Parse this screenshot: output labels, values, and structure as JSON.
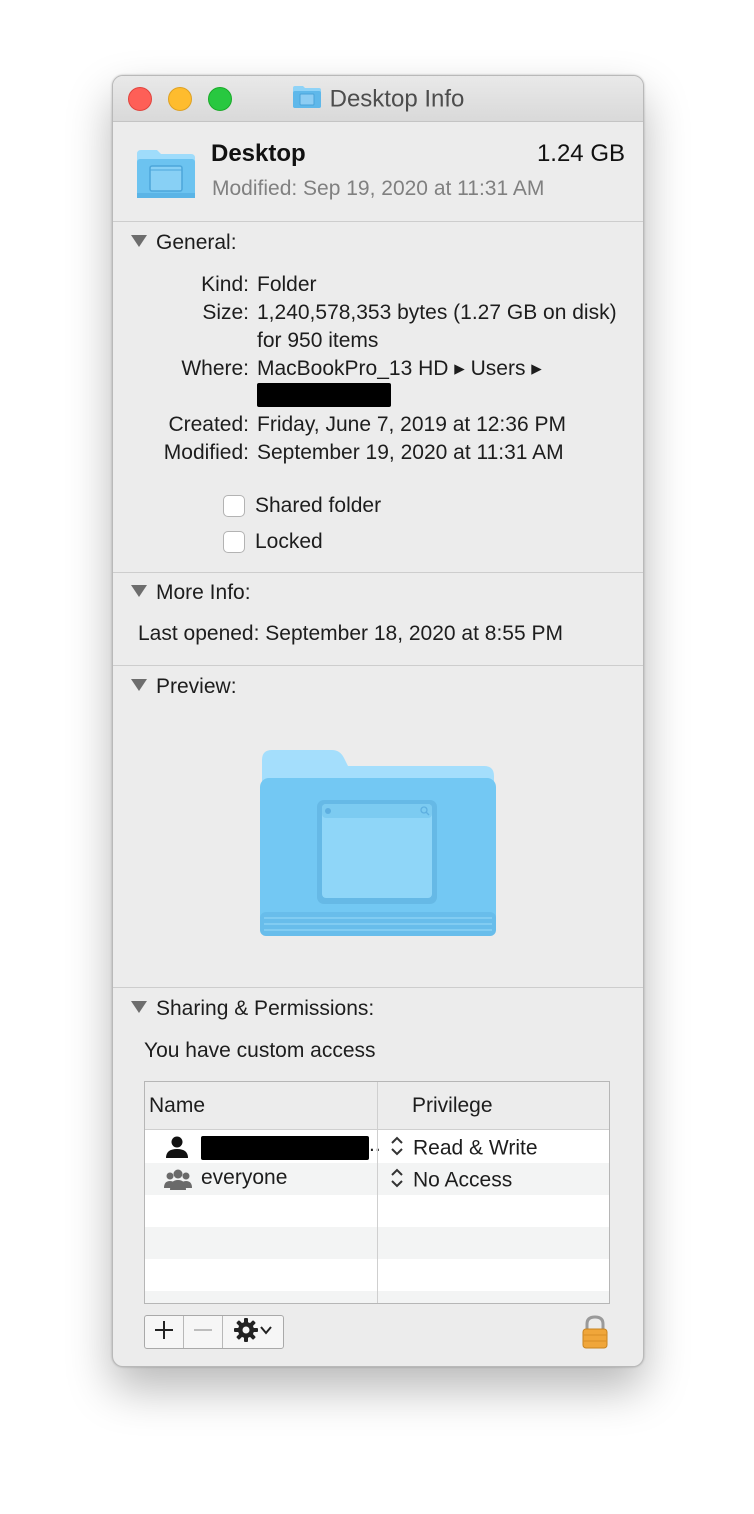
{
  "window": {
    "title": "Desktop Info"
  },
  "header": {
    "name": "Desktop",
    "size": "1.24 GB",
    "modified": "Modified: Sep 19, 2020 at 11:31 AM"
  },
  "general": {
    "heading": "General:",
    "rows": [
      {
        "label": "Kind:",
        "value": "Folder"
      },
      {
        "label": "Size:",
        "value": "1,240,578,353 bytes (1.27 GB on disk) for 950 items"
      },
      {
        "label": "Where:",
        "value": "MacBookPro_13 HD ▸ Users ▸"
      },
      {
        "label": "Created:",
        "value": "Friday, June 7, 2019 at 12:36 PM"
      },
      {
        "label": "Modified:",
        "value": "September 19, 2020 at 11:31 AM"
      }
    ],
    "shared_folder": {
      "label": "Shared folder",
      "checked": false
    },
    "locked": {
      "label": "Locked",
      "checked": false
    }
  },
  "more_info": {
    "heading": "More Info:",
    "last_opened_label": "Last opened:",
    "last_opened_value": "September 18, 2020 at 8:55 PM"
  },
  "preview": {
    "heading": "Preview:"
  },
  "sharing": {
    "heading": "Sharing & Permissions:",
    "access_text": "You have custom access",
    "columns": [
      "Name",
      "Privilege"
    ],
    "rows": [
      {
        "name": "",
        "icon": "user-icon",
        "privilege": "Read & Write"
      },
      {
        "name": "everyone",
        "icon": "group-icon",
        "privilege": "No Access"
      }
    ]
  },
  "toolbar": {
    "add": "+",
    "remove": "−",
    "action": "gear-icon"
  },
  "colors": {
    "close": "#fe5f57",
    "minimize": "#febc2e",
    "zoom": "#28c840",
    "folder": "#6ec6f2"
  }
}
